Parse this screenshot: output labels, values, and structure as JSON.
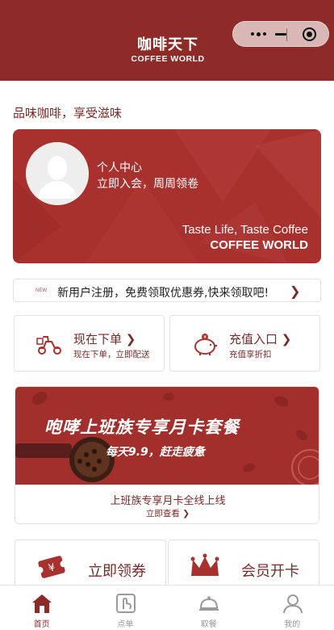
{
  "header": {
    "logo_cn": "咖啡天下",
    "logo_en": "COFFEE WORLD"
  },
  "capsule": {
    "more_icon": "more-dots-icon",
    "minimize_icon": "minimize-icon",
    "close_icon": "target-close-icon"
  },
  "slogan": "品味咖啡，享受滋味",
  "member": {
    "title": "个人中心",
    "subtitle": "立即入会，周周领卷",
    "tagline": "Taste Life, Taste Coffee",
    "brand": "COFFEE WORLD"
  },
  "notice": {
    "badge": "NEW",
    "text": "新用户注册，免费领取优惠券,快来领取吧!",
    "arrow": "❯"
  },
  "actions": [
    {
      "title": "现在下单 ❯",
      "subtitle": "现在下单，立即配送",
      "icon": "scooter-icon"
    },
    {
      "title": "充值入口 ❯",
      "subtitle": "充值享折扣",
      "icon": "piggy-bank-icon"
    }
  ],
  "promo": {
    "banner_title": "咆哮上班族专享月卡套餐",
    "banner_subtitle": "每天9.9，赶走疲惫",
    "title": "上班族专享月卡全线上线",
    "link": "立即查看 ❯"
  },
  "bottom_cards": [
    {
      "label": "立即领券",
      "icon": "coupon-icon"
    },
    {
      "label": "会员开卡",
      "icon": "crown-icon"
    }
  ],
  "tabbar": [
    {
      "label": "首页",
      "icon": "home-icon",
      "active": true
    },
    {
      "label": "点单",
      "icon": "order-icon",
      "active": false
    },
    {
      "label": "取餐",
      "icon": "cloche-icon",
      "active": false
    },
    {
      "label": "我的",
      "icon": "user-icon",
      "active": false
    }
  ],
  "colors": {
    "brand": "#8e2a28",
    "card": "#a8312e",
    "accent_text": "#7a2a28"
  }
}
